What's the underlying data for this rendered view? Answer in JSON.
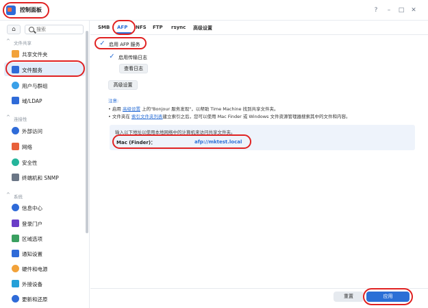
{
  "app": {
    "title": "控制面板",
    "window_buttons": [
      "?",
      "–",
      "□",
      "✕"
    ]
  },
  "sidebar": {
    "home_icon": "⌂",
    "search_placeholder": "搜索",
    "sections": [
      {
        "title": "文件共享",
        "chevron": "^"
      },
      {
        "title": "连接性",
        "chevron": "^"
      },
      {
        "title": "系统",
        "chevron": "^"
      }
    ],
    "items": [
      {
        "label": "共享文件夹",
        "icon": "folder-share-icon",
        "color": "#f2a23a"
      },
      {
        "label": "文件服务",
        "icon": "file-services-icon",
        "color": "#2f6bd8"
      },
      {
        "label": "用户与群组",
        "icon": "users-icon",
        "color": "#3aa0e8"
      },
      {
        "label": "域/LDAP",
        "icon": "domain-icon",
        "color": "#2f6bd8"
      },
      {
        "label": "外部访问",
        "icon": "external-access-icon",
        "color": "#2f6bd8"
      },
      {
        "label": "网络",
        "icon": "network-icon",
        "color": "#e8603a"
      },
      {
        "label": "安全性",
        "icon": "security-icon",
        "color": "#25b59b"
      },
      {
        "label": "终端机和 SNMP",
        "icon": "terminal-icon",
        "color": "#6b7686"
      },
      {
        "label": "信息中心",
        "icon": "info-center-icon",
        "color": "#2f6bd8"
      },
      {
        "label": "登录门户",
        "icon": "login-portal-icon",
        "color": "#6a3dc8"
      },
      {
        "label": "区域选项",
        "icon": "regional-options-icon",
        "color": "#3aa060"
      },
      {
        "label": "通知设置",
        "icon": "notification-icon",
        "color": "#2f6bd8"
      },
      {
        "label": "硬件和电源",
        "icon": "hardware-power-icon",
        "color": "#f2a23a"
      },
      {
        "label": "外接设备",
        "icon": "external-devices-icon",
        "color": "#25a0d8"
      },
      {
        "label": "更新和还原",
        "icon": "update-restore-icon",
        "color": "#2f6bd8"
      }
    ]
  },
  "tabs": [
    "SMB",
    "AFP",
    "NFS",
    "FTP",
    "rsync",
    "高级设置"
  ],
  "afp": {
    "enable_label": "启用 AFP 服务",
    "log_label": "启用传输日志",
    "view_log_button": "查看日志",
    "advanced_button": "高级设置",
    "check_mark": "✓"
  },
  "notes": {
    "title": "注意:",
    "bullet": "•",
    "line1": {
      "before": "启用 ",
      "link": "高级设置",
      "after": " 上的\"Bonjour 服务发现\"，以帮助 Time Machine 找到共享文件夹。"
    },
    "line2": {
      "before": "文件夹在 ",
      "link": "索引文件夹列表",
      "after": "建立索引之后，您可以使用 Mac Finder 或 Windows 文件资源管理器搜索其中的文件和内容。"
    }
  },
  "info": {
    "text": "输入以下地址以使用本地网络中的计算机来访问共享文件夹。",
    "mac_label": "Mac (Finder)：",
    "mac_value": "afp://mktest.local"
  },
  "footer": {
    "reset_button": "重置",
    "apply_button": "应用"
  }
}
